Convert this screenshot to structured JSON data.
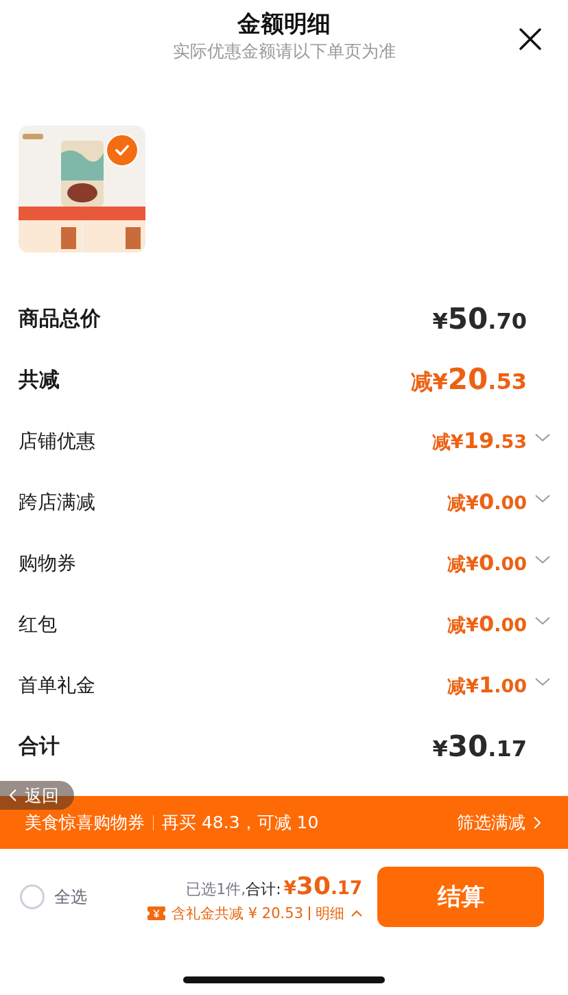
{
  "header": {
    "title": "金额明细",
    "subtitle": "实际优惠金额请以下单页为准"
  },
  "product": {
    "kind": "picture",
    "selected": true
  },
  "rows": [
    {
      "label": "商品总价",
      "kind": "major",
      "discount": false,
      "prefix": "",
      "currency": "¥",
      "int": "50",
      "dec": ".70",
      "expandable": false
    },
    {
      "label": "共减",
      "kind": "major",
      "discount": true,
      "prefix": "减",
      "currency": "¥",
      "int": "20",
      "dec": ".53",
      "expandable": false
    },
    {
      "label": "店铺优惠",
      "kind": "minor",
      "discount": true,
      "prefix": "减",
      "currency": "¥",
      "int": "19",
      "dec": ".53",
      "expandable": true
    },
    {
      "label": "跨店满减",
      "kind": "minor",
      "discount": true,
      "prefix": "减",
      "currency": "¥",
      "int": "0",
      "dec": ".00",
      "expandable": true
    },
    {
      "label": "购物券",
      "kind": "minor",
      "discount": true,
      "prefix": "减",
      "currency": "¥",
      "int": "0",
      "dec": ".00",
      "expandable": true
    },
    {
      "label": "红包",
      "kind": "minor",
      "discount": true,
      "prefix": "减",
      "currency": "¥",
      "int": "0",
      "dec": ".00",
      "expandable": true
    },
    {
      "label": "首单礼金",
      "kind": "minor",
      "discount": true,
      "prefix": "减",
      "currency": "¥",
      "int": "1",
      "dec": ".00",
      "expandable": true
    },
    {
      "label": "合计",
      "kind": "major",
      "discount": false,
      "prefix": "",
      "currency": "¥",
      "int": "30",
      "dec": ".17",
      "expandable": false
    }
  ],
  "banner": {
    "title": "美食惊喜购物券",
    "detail": "再买 48.3，可减 10",
    "action": "筛选满减"
  },
  "back_button": {
    "label": "返回"
  },
  "footer": {
    "select_all": {
      "label": "全选",
      "checked": false
    },
    "selected_text": "已选1件,",
    "total_label": "合计:",
    "currency": "¥",
    "int": "30",
    "dec": ".17",
    "saving": "含礼金共减 ¥ 20.53",
    "detail_link": "明细",
    "checkout": "结算"
  }
}
